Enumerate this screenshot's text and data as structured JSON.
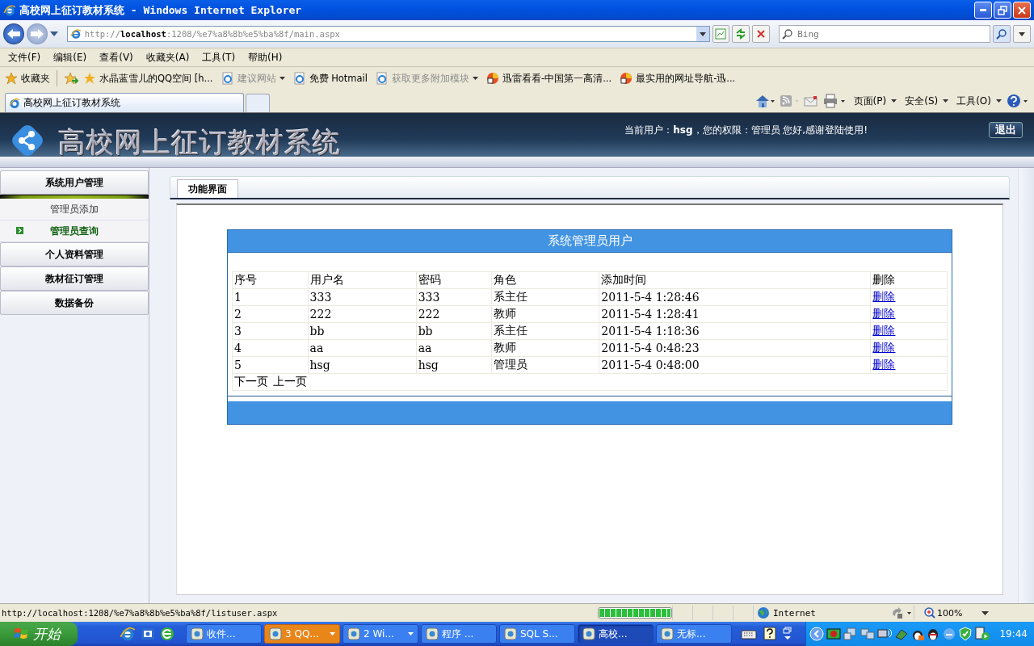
{
  "window": {
    "title": "高校网上征订教材系统 - Windows Internet Explorer"
  },
  "address_bar": {
    "url_prefix": "http://",
    "url_host": "localhost",
    "url_rest": ":1208/%e7%a8%8b%e5%ba%8f/main.aspx",
    "search_placeholder": "Bing"
  },
  "menu_bar": [
    "文件(F)",
    "编辑(E)",
    "查看(V)",
    "收藏夹(A)",
    "工具(T)",
    "帮助(H)"
  ],
  "favorites_bar": {
    "button": "收藏夹",
    "items": [
      {
        "kind": "star",
        "label": "水晶蓝雪儿的QQ空间 [h...",
        "disabled": false,
        "has_menu": false
      },
      {
        "kind": "page",
        "label": "建议网站",
        "disabled": true,
        "has_menu": true
      },
      {
        "kind": "page",
        "label": "免费 Hotmail",
        "disabled": false,
        "has_menu": false
      },
      {
        "kind": "page",
        "label": "获取更多附加模块",
        "disabled": true,
        "has_menu": true
      },
      {
        "kind": "app",
        "label": "迅雷看看-中国第一高清...",
        "disabled": false,
        "has_menu": false
      },
      {
        "kind": "app",
        "label": "最实用的网址导航-迅...",
        "disabled": false,
        "has_menu": false
      }
    ]
  },
  "tabs": [
    {
      "label": "高校网上征订教材系统",
      "selected": true
    }
  ],
  "command_bar": [
    "页面(P)",
    "安全(S)",
    "工具(O)"
  ],
  "page": {
    "site_title": "高校网上征订教材系统",
    "user_info": "当前用户：**hsg**，您的权限：管理员 您好,感谢登陆使用!",
    "logout": "退出",
    "sidebar": [
      {
        "title": "系统用户管理",
        "children": [
          {
            "label": "管理员添加",
            "selected": false
          },
          {
            "label": "管理员查询",
            "selected": true
          }
        ]
      },
      {
        "title": "个人资料管理"
      },
      {
        "title": "教材征订管理"
      },
      {
        "title": "数据备份"
      }
    ],
    "content_tab": "功能界面",
    "panel": {
      "title": "系统管理员用户",
      "columns": [
        "序号",
        "用户名",
        "密码",
        "角色",
        "添加时间",
        "删除"
      ],
      "rows": [
        [
          "1",
          "333",
          "333",
          "系主任",
          "2011-5-4 1:28:46",
          "删除"
        ],
        [
          "2",
          "222",
          "222",
          "教师",
          "2011-5-4 1:28:41",
          "删除"
        ],
        [
          "3",
          "bb",
          "bb",
          "系主任",
          "2011-5-4 1:18:36",
          "删除"
        ],
        [
          "4",
          "aa",
          "aa",
          "教师",
          "2011-5-4 0:48:23",
          "删除"
        ],
        [
          "5",
          "hsg",
          "hsg",
          "管理员",
          "2011-5-4 0:48:00",
          "删除"
        ]
      ],
      "pager": [
        "下一页",
        "上一页"
      ]
    }
  },
  "status_bar": {
    "url": "http://localhost:1208/%e7%a8%8b%e5%ba%8f/listuser.aspx",
    "level": 1,
    "zone": "Internet",
    "zoom": "100%"
  },
  "taskbar": {
    "start": "开始",
    "tasks": [
      {
        "label": "收件...",
        "selected": false,
        "attention": false,
        "has_menu": false
      },
      {
        "label": "3 QQ...",
        "selected": false,
        "attention": true,
        "has_menu": true
      },
      {
        "label": "2 Wi...",
        "selected": false,
        "attention": false,
        "has_menu": true
      },
      {
        "label": "程序 ...",
        "selected": false,
        "attention": false,
        "has_menu": false
      },
      {
        "label": "SQL S...",
        "selected": false,
        "attention": false,
        "has_menu": false
      },
      {
        "label": "高校...",
        "selected": true,
        "attention": false,
        "has_menu": false
      },
      {
        "label": "无标...",
        "selected": false,
        "attention": false,
        "has_menu": false
      }
    ],
    "clock": "19:44"
  }
}
